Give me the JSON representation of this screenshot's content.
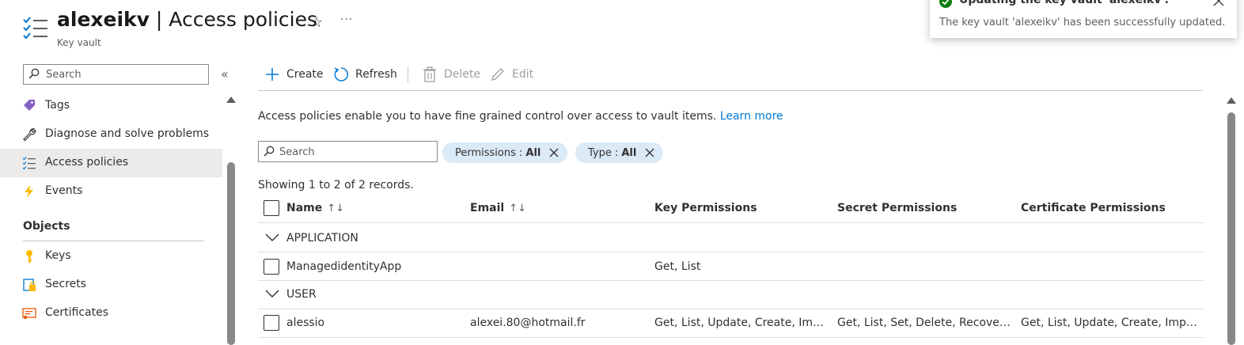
{
  "header": {
    "resource_name": "alexeikv",
    "separator": " | ",
    "page_name": "Access policies",
    "subtitle": "Key vault",
    "more": "···"
  },
  "sidebar": {
    "search_placeholder": "Search",
    "collapse": "«",
    "items": [
      {
        "label": "Tags",
        "icon": "tag-icon"
      },
      {
        "label": "Diagnose and solve problems",
        "icon": "wrench-icon"
      },
      {
        "label": "Access policies",
        "icon": "access-policies-icon",
        "active": true
      },
      {
        "label": "Events",
        "icon": "lightning-icon"
      }
    ],
    "section_objects": "Objects",
    "objects": [
      {
        "label": "Keys",
        "icon": "key-icon"
      },
      {
        "label": "Secrets",
        "icon": "secret-icon"
      },
      {
        "label": "Certificates",
        "icon": "certificate-icon"
      }
    ]
  },
  "toolbar": {
    "create": "Create",
    "refresh": "Refresh",
    "delete": "Delete",
    "edit": "Edit"
  },
  "content": {
    "description": "Access policies enable you to have fine grained control over access to vault items.",
    "learn_more": "Learn more",
    "search_placeholder": "Search",
    "filters": [
      {
        "key": "Permissions : ",
        "value": "All"
      },
      {
        "key": "Type : ",
        "value": "All"
      }
    ],
    "records_text": "Showing 1 to 2 of 2 records."
  },
  "table": {
    "columns": {
      "name": "Name",
      "email": "Email",
      "key_permissions": "Key Permissions",
      "secret_permissions": "Secret Permissions",
      "certificate_permissions": "Certificate Permissions"
    },
    "sort_glyph": "↑↓",
    "groups": [
      {
        "label": "APPLICATION",
        "rows": [
          {
            "name": "ManagedidentityApp",
            "email": "",
            "key": "Get, List",
            "secret": "",
            "certificate": ""
          }
        ]
      },
      {
        "label": "USER",
        "rows": [
          {
            "name": "alessio",
            "email": "alexei.80@hotmail.fr",
            "key": "Get, List, Update, Create, Import,...",
            "secret": "Get, List, Set, Delete, Recover, Ba...",
            "certificate": "Get, List, Update, Create, Import, ..."
          }
        ]
      }
    ]
  },
  "toast": {
    "title": "Updating the key vault 'alexeikv'.",
    "message": "The key vault 'alexeikv' has been successfully updated."
  },
  "colors": {
    "accent": "#0078d4",
    "pill_bg": "#dbeaf7",
    "success": "#107c10"
  }
}
